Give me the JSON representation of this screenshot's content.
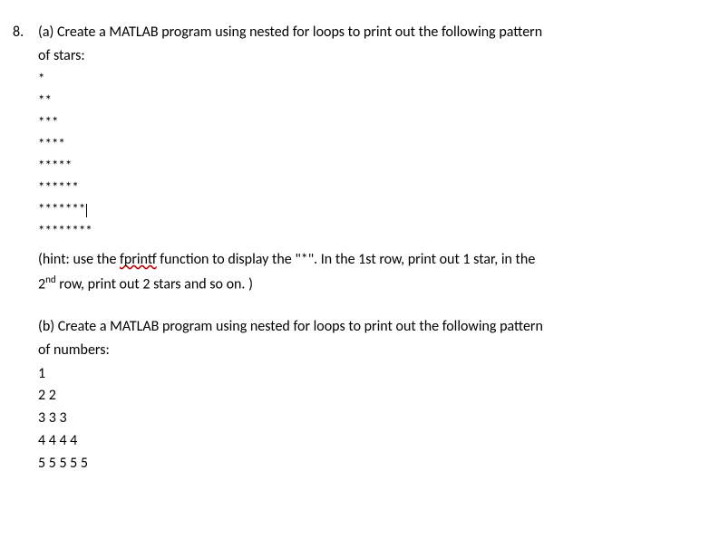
{
  "question_number": "8.",
  "part_a": {
    "text_line1": "(a) Create a MATLAB program using nested for loops to print out the following pattern",
    "text_line2": "of stars:",
    "pattern": [
      "*",
      "**",
      "***",
      "****",
      "*****",
      "******",
      "*******",
      "********"
    ],
    "hint_prefix": "(hint: use the ",
    "hint_spellword": "fprintf",
    "hint_mid": " function to display the \"*\". In the 1st row, print out 1 star, in the",
    "hint_line2_pre": "2",
    "hint_line2_sup": "nd",
    "hint_line2_post": " row, print out 2 stars and so on. )"
  },
  "part_b": {
    "text_line1": "(b) Create a MATLAB program using nested for loops to print out the following pattern",
    "text_line2": "of numbers:",
    "pattern": [
      "1",
      "2 2",
      "3 3 3",
      "4 4 4 4",
      "5 5 5 5 5"
    ]
  }
}
